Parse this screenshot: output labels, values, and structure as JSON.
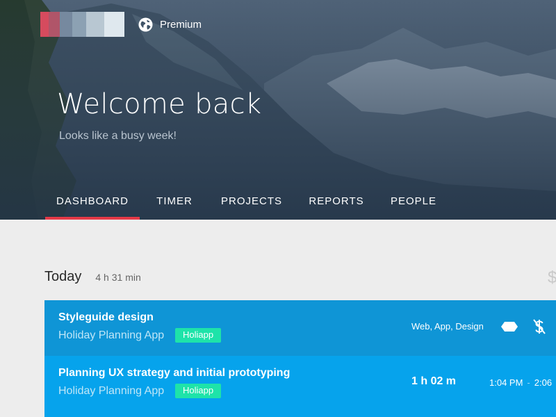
{
  "header": {
    "brand_logo": {
      "icon": "brand-logo-pixelated",
      "colors": [
        "#d64b5e",
        "#b05569",
        "#76899f",
        "#8ca1b3",
        "#b8c7d2",
        "#dfe8ee"
      ]
    },
    "plan_icon": "globe-icon",
    "plan_label": "Premium",
    "title": "Welcome back",
    "subtitle": "Looks like a busy week!"
  },
  "tabs": [
    {
      "label": "DASHBOARD",
      "active": true
    },
    {
      "label": "TIMER",
      "active": false
    },
    {
      "label": "PROJECTS",
      "active": false
    },
    {
      "label": "REPORTS",
      "active": false
    },
    {
      "label": "PEOPLE",
      "active": false
    }
  ],
  "today": {
    "label": "Today",
    "total": "4 h 31 min"
  },
  "entries": [
    {
      "title": "Styleguide design",
      "project": "Holiday Planning App",
      "client_badge": "Holiapp",
      "tags": "Web, App, Design",
      "tag_icon": "tag-icon",
      "billing_icon": "not-billable-dollar-icon"
    },
    {
      "title": "Planning UX strategy and initial prototyping",
      "project": "Holiday Planning App",
      "client_badge": "Holiapp",
      "duration": "1 h 02 m",
      "start_time": "1:04 PM",
      "range_separator": "-",
      "end_time": "2:06"
    }
  ],
  "colors": {
    "accent_red": "#e53947",
    "entry_blue_dark": "#0f95d6",
    "entry_blue_light": "#06a3ec",
    "badge_green": "#1ee3a9",
    "page_bg": "#ededed"
  }
}
